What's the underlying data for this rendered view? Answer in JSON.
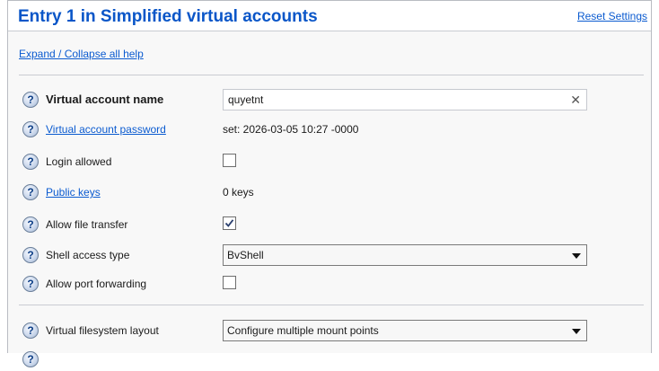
{
  "header": {
    "title": "Entry 1 in Simplified virtual accounts",
    "reset_label": "Reset Settings"
  },
  "expand_label": "Expand / Collapse all help",
  "fields": {
    "account_name": {
      "label": "Virtual account name",
      "value": "quyetnt",
      "clear_icon": "clear-x-icon"
    },
    "password": {
      "label": "Virtual account password",
      "value": "set:  2026-03-05 10:27 -0000"
    },
    "login_allowed": {
      "label": "Login allowed",
      "checked": false
    },
    "public_keys": {
      "label": "Public keys",
      "value": "0 keys"
    },
    "file_transfer": {
      "label": "Allow file transfer",
      "checked": true
    },
    "shell_access": {
      "label": "Shell access type",
      "selected": "BvShell"
    },
    "port_forwarding": {
      "label": "Allow port forwarding",
      "checked": false
    },
    "vfs_layout": {
      "label": "Virtual filesystem layout",
      "selected": "Configure multiple mount points"
    }
  },
  "help_icon_glyph": "?",
  "colors": {
    "title": "#0a56c8",
    "link": "#0b5bd0",
    "help_icon": "#0d3e86"
  }
}
